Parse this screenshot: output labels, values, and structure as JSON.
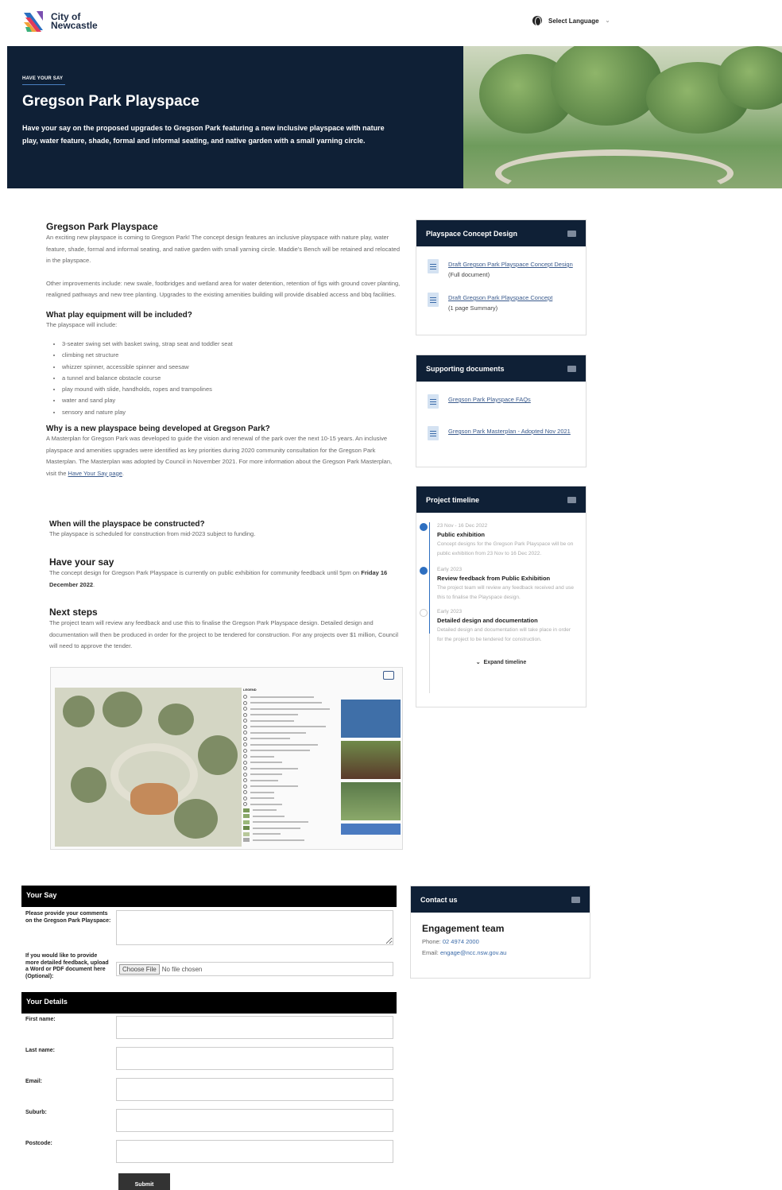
{
  "header": {
    "logo_line1": "City of",
    "logo_line2": "Newcastle",
    "language_label": "Select Language"
  },
  "hero": {
    "kicker": "HAVE YOUR SAY",
    "title": "Gregson Park Playspace",
    "description": "Have your say on the proposed upgrades to Gregson Park featuring a new inclusive playspace with nature play, water feature, shade, formal and informal seating, and native garden with a small yarning circle."
  },
  "main": {
    "title": "Gregson Park Playspace",
    "intro": "An exciting new playspace is coming to Gregson Park! The concept design features an inclusive playspace with nature play, water feature, shade, formal and informal seating, and native garden with small yarning circle. Maddie's Bench will be retained and relocated in the playspace.",
    "improvements": "Other improvements include: new swale, footbridges and wetland area for water detention, retention of figs with ground cover planting, realigned pathways and new tree planting. Upgrades to the existing amenities building will provide disabled access and bbq facilities.",
    "equipment_heading": "What play equipment will be included?",
    "equipment_intro": "The playspace will include:",
    "equipment": [
      "3-seater swing set with basket swing, strap seat and toddler seat",
      "climbing net structure",
      "whizzer spinner, accessible spinner and seesaw",
      "a tunnel and balance obstacle course",
      "play mound with slide, handholds, ropes and trampolines",
      "water and sand play",
      "sensory and nature play"
    ],
    "why_heading": "Why is a new playspace being developed at Gregson Park?",
    "why_text": "A Masterplan for Gregson Park was developed to guide the vision and renewal of the park over the next 10-15 years. An inclusive playspace and amenities upgrades were identified as key priorities during 2020 community consultation for the Gregson Park Masterplan. The Masterplan was adopted by Council in November 2021. For more information about the Gregson Park Masterplan, visit the",
    "why_link": "Have Your Say page",
    "when_heading": "When will the playspace be constructed?",
    "when_text": "The playspace is scheduled for construction from mid-2023 subject to funding.",
    "say_heading": "Have your say",
    "say_text": "The concept design for Gregson Park Playspace is currently on public exhibition for community feedback until 5pm on",
    "say_date": "Friday 16 December 2022",
    "next_heading": "Next steps",
    "next_text": "The project team will review any feedback and use this to finalise the Gregson Park Playspace design. Detailed design and documentation will then be produced in order for the project to be tendered for construction. For any projects over $1 million, Council will need to approve the tender."
  },
  "map": {
    "legend_title": "LEGEND"
  },
  "concept_card": {
    "title": "Playspace Concept Design",
    "docs": [
      {
        "link": "Draft Gregson Park Playspace Concept Design",
        "suffix": "(Full document)"
      },
      {
        "link": "Draft Gregson Park Playspace Concept",
        "suffix": "(1 page Summary)"
      }
    ]
  },
  "supporting_card": {
    "title": "Supporting documents",
    "docs": [
      {
        "link": "Gregson Park Playspace FAQs"
      },
      {
        "link": "Gregson Park Masterplan - Adopted Nov 2021"
      }
    ]
  },
  "timeline": {
    "title": "Project timeline",
    "items": [
      {
        "date": "23 Nov - 16 Dec 2022",
        "title": "Public exhibition",
        "desc": "Concept designs for the Gregson Park Playspace will be on public exhibition from 23 Nov to 16 Dec 2022."
      },
      {
        "date": "Early 2023",
        "title": "Review feedback from Public Exhibition",
        "desc": "The project team will review any feedback received and use this to finalise the Playspace design."
      },
      {
        "date": "Early 2023",
        "title": "Detailed design and documentation",
        "desc": "Detailed design and documentation will take place in order for the project to be tendered for construction."
      }
    ],
    "expand_label": "Expand timeline"
  },
  "form": {
    "your_say_heading": "Your Say",
    "comments_label": "Please provide your comments on the Gregson Park Playspace:",
    "upload_label": "If you would like to provide more detailed feedback, upload a Word or PDF document here (Optional):",
    "choose_file": "Choose File",
    "no_file": "No file chosen",
    "details_heading": "Your Details",
    "first_name": "First name:",
    "last_name": "Last name:",
    "email": "Email:",
    "suburb": "Suburb:",
    "postcode": "Postcode:",
    "submit": "Submit"
  },
  "contact": {
    "title": "Contact us",
    "name": "Engagement team",
    "phone_label": "Phone:",
    "phone": "02 4974 2000",
    "email_label": "Email:",
    "email": "engage@ncc.nsw.gov.au"
  },
  "colors": {
    "navy": "#0f2036",
    "link": "#3a5a8c",
    "accent": "#2e6fc0"
  }
}
